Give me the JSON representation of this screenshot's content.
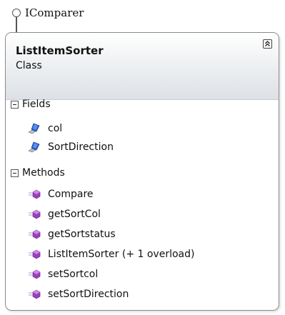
{
  "interface": {
    "name": "IComparer"
  },
  "class": {
    "name": "ListItemSorter",
    "kind": "Class",
    "collapse_icon": "double-chevron-up-icon"
  },
  "fields": {
    "label": "Fields",
    "icon": "field-icon",
    "items": [
      "col",
      "SortDirection"
    ]
  },
  "methods": {
    "label": "Methods",
    "icon": "method-icon",
    "items": [
      "Compare",
      "getSortCol",
      "getSortstatus",
      "ListItemSorter (+ 1 overload)",
      "setSortcol",
      "setSortDirection"
    ]
  },
  "colors": {
    "field_blue": "#2a63d4",
    "method_purple": "#9b3fc0",
    "header_gradient_end": "#dde1e5",
    "border": "#8a8a8a"
  }
}
